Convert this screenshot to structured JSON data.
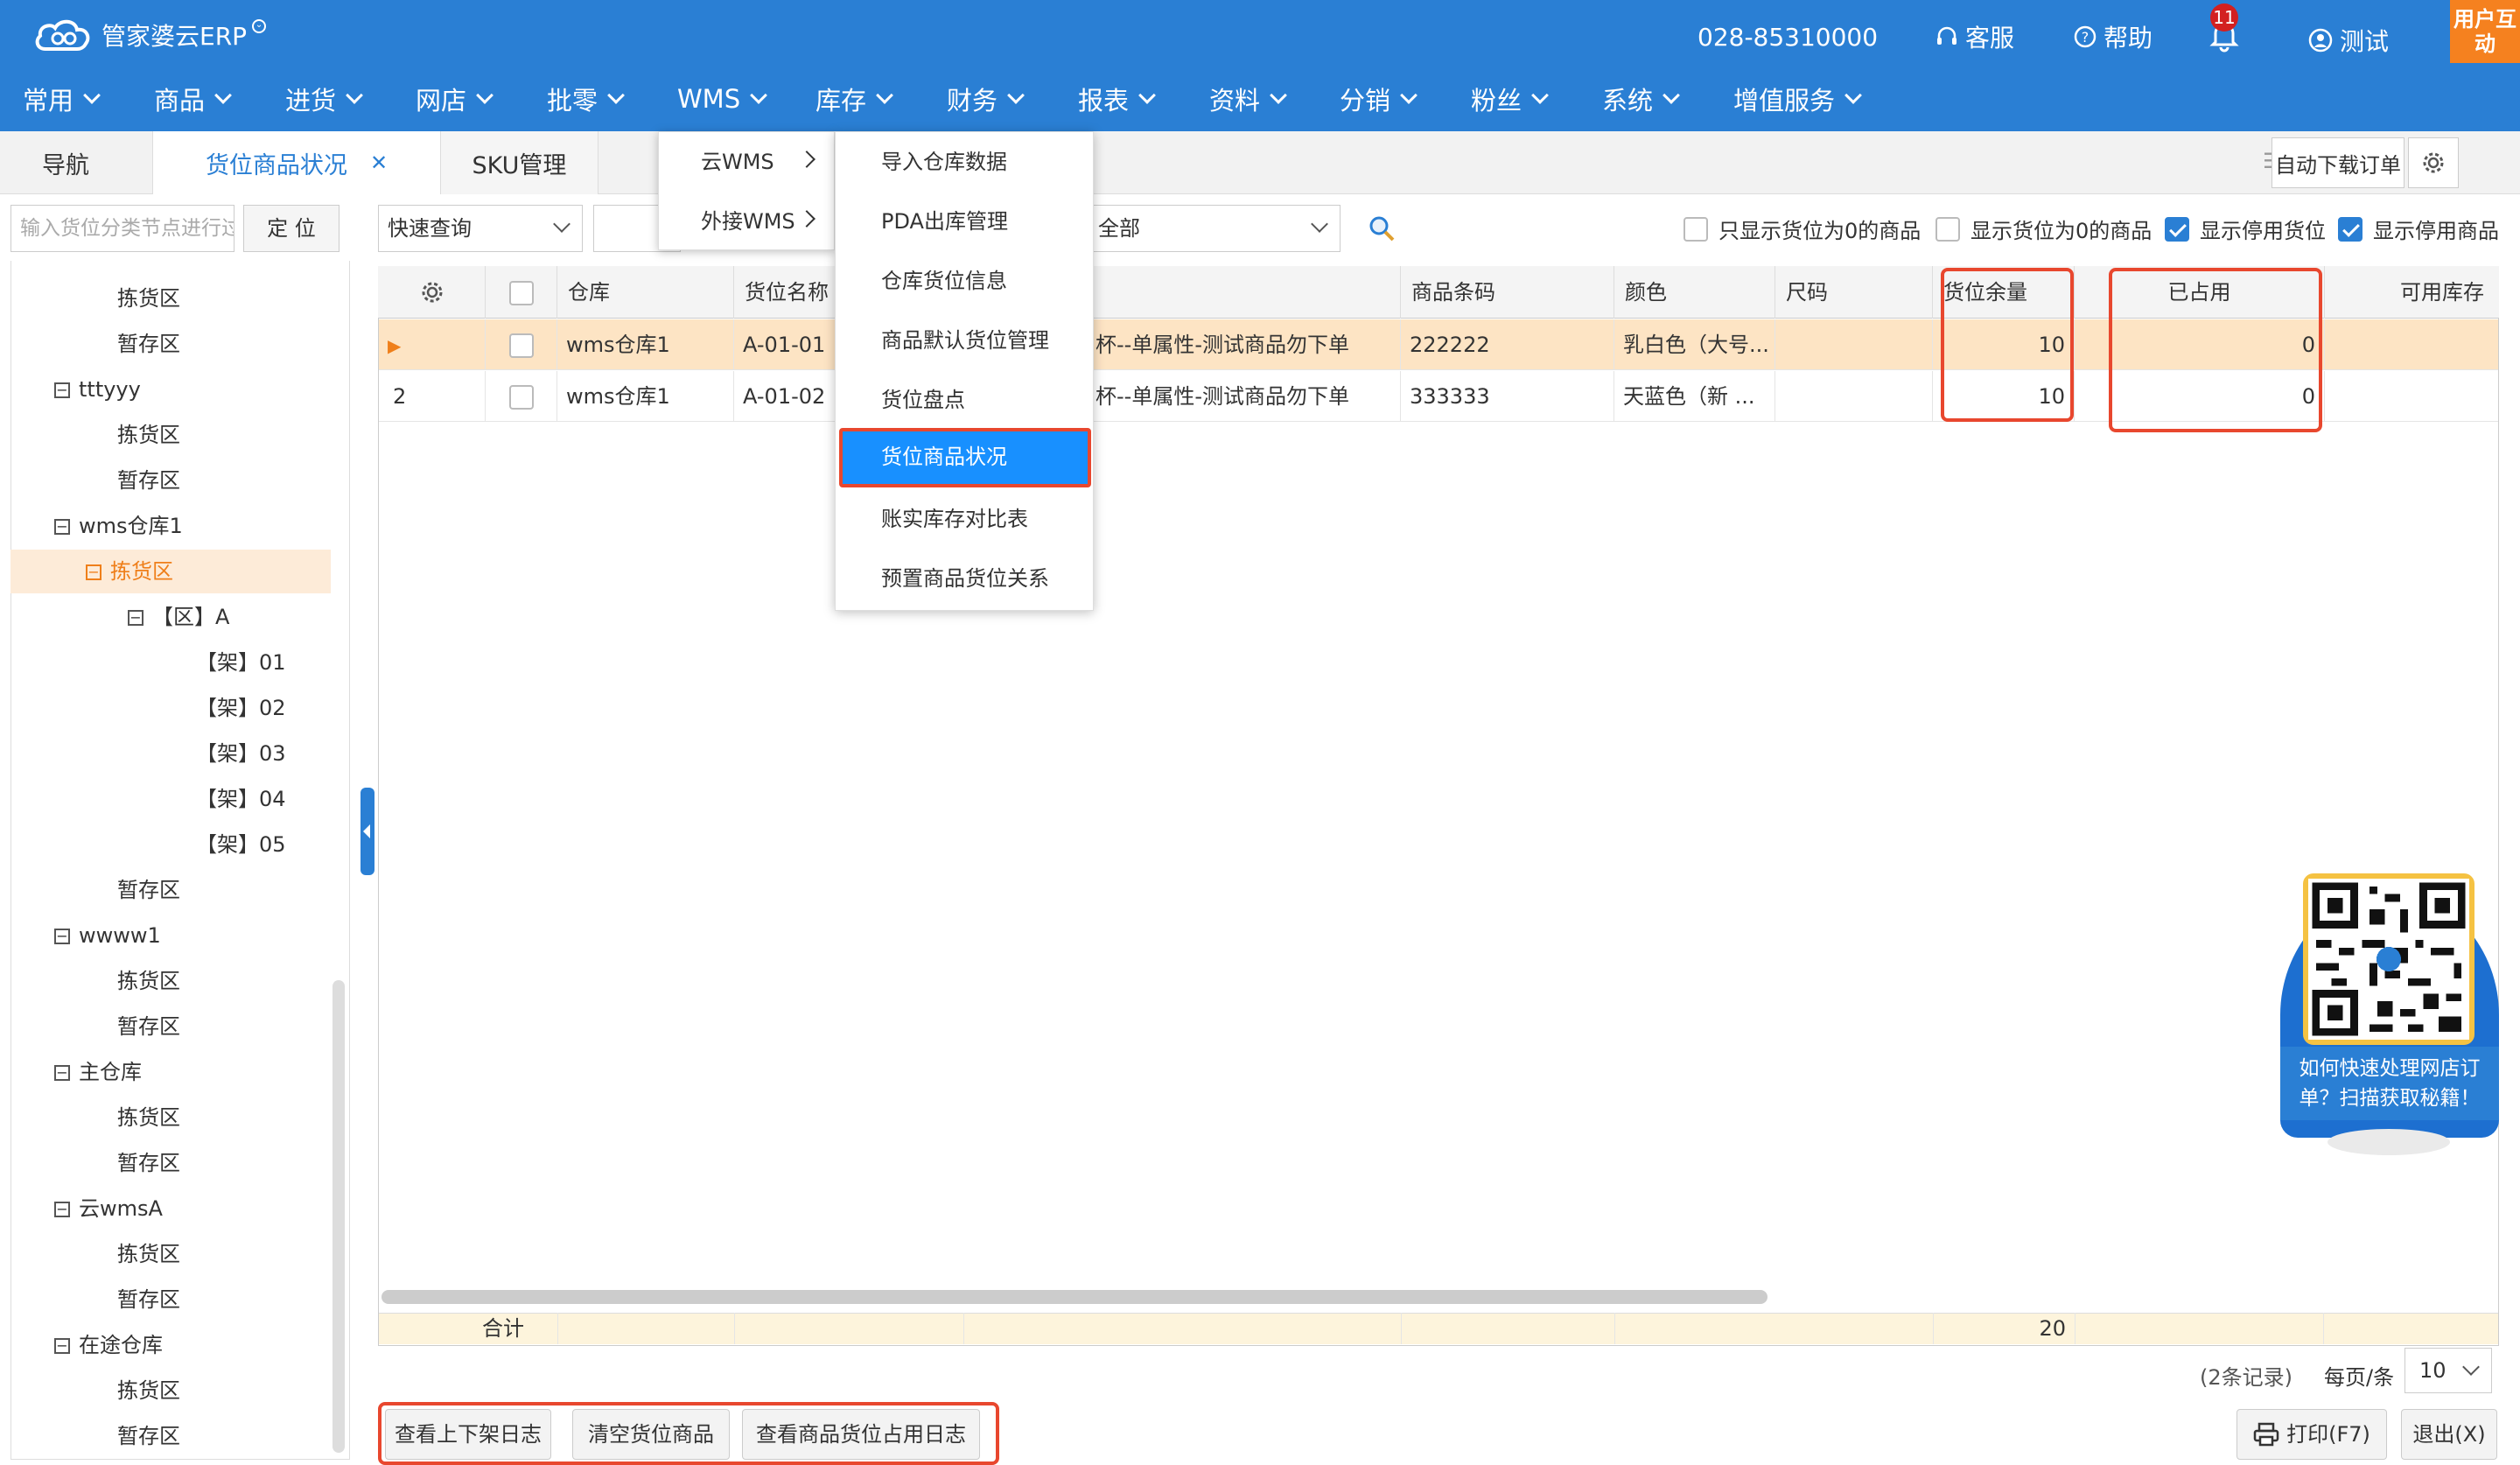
{
  "app": {
    "logo_text": "管家婆云ERP",
    "phone": "028-85310000",
    "service": "客服",
    "help": "帮助",
    "notifications": "11",
    "user": "测试",
    "user_interact": "用户互动"
  },
  "nav": [
    {
      "label": "常用"
    },
    {
      "label": "商品"
    },
    {
      "label": "进货"
    },
    {
      "label": "网店"
    },
    {
      "label": "批零"
    },
    {
      "label": "WMS"
    },
    {
      "label": "库存"
    },
    {
      "label": "财务"
    },
    {
      "label": "报表"
    },
    {
      "label": "资料"
    },
    {
      "label": "分销"
    },
    {
      "label": "粉丝"
    },
    {
      "label": "系统"
    },
    {
      "label": "增值服务"
    }
  ],
  "tabs": {
    "nav": "导航",
    "active": "货位商品状况",
    "sku": "SKU管理",
    "close": "✕"
  },
  "toolbar": {
    "auto_download": "自动下载订单"
  },
  "tree": {
    "search_placeholder": "输入货位分类节点进行过滤",
    "locate": "定 位",
    "nodes": [
      {
        "label": "拣货区"
      },
      {
        "label": "暂存区"
      },
      {
        "label": "tttyyy"
      },
      {
        "label": "拣货区"
      },
      {
        "label": "暂存区"
      },
      {
        "label": "wms仓库1"
      },
      {
        "label": "拣货区"
      },
      {
        "label": "【区】A"
      },
      {
        "label": "【架】01"
      },
      {
        "label": "【架】02"
      },
      {
        "label": "【架】03"
      },
      {
        "label": "【架】04"
      },
      {
        "label": "【架】05"
      },
      {
        "label": "暂存区"
      },
      {
        "label": "wwww1"
      },
      {
        "label": "拣货区"
      },
      {
        "label": "暂存区"
      },
      {
        "label": "主仓库"
      },
      {
        "label": "拣货区"
      },
      {
        "label": "暂存区"
      },
      {
        "label": "云wmsA"
      },
      {
        "label": "拣货区"
      },
      {
        "label": "暂存区"
      },
      {
        "label": "在途仓库"
      },
      {
        "label": "拣货区"
      },
      {
        "label": "暂存区"
      }
    ]
  },
  "filters": {
    "quick": "快速查询",
    "scope": "全部",
    "chk_only_zero": "只显示货位为0的商品",
    "chk_show_zero": "显示货位为0的商品",
    "chk_disabled_loc": "显示停用货位",
    "chk_disabled_goods": "显示停用商品"
  },
  "grid": {
    "headers": {
      "warehouse": "仓库",
      "location": "货位名称",
      "barcode": "商品条码",
      "color": "颜色",
      "size": "尺码",
      "remain": "货位余量",
      "occupied": "已占用",
      "available": "可用库存"
    },
    "rows": [
      {
        "idx": "",
        "warehouse": "wms仓库1",
        "location": "A-01-01",
        "name": "杯--单属性-测试商品勿下单",
        "barcode": "222222",
        "color": "乳白色（大号...",
        "size": "",
        "remain": "10",
        "occupied": "0"
      },
      {
        "idx": "2",
        "warehouse": "wms仓库1",
        "location": "A-01-02",
        "name": "杯--单属性-测试商品勿下单",
        "barcode": "333333",
        "color": "天蓝色（新 ...",
        "size": "",
        "remain": "10",
        "occupied": "0"
      }
    ],
    "sum_label": "合计",
    "sum_remain": "20"
  },
  "menu_wms": {
    "items": [
      {
        "label": "云WMS"
      },
      {
        "label": "外接WMS"
      }
    ],
    "sub": [
      {
        "label": "导入仓库数据"
      },
      {
        "label": "PDA出库管理"
      },
      {
        "label": "仓库货位信息"
      },
      {
        "label": "商品默认货位管理"
      },
      {
        "label": "货位盘点"
      },
      {
        "label": "货位商品状况"
      },
      {
        "label": "账实库存对比表"
      },
      {
        "label": "预置商品货位关系"
      }
    ]
  },
  "pager": {
    "records": "(2条记录)",
    "per_page_label": "每页/条",
    "per_page": "10"
  },
  "bottom_buttons": {
    "log_shelf": "查看上下架日志",
    "clear_loc": "清空货位商品",
    "log_occupy": "查看商品货位占用日志",
    "print": "打印(F7)",
    "exit": "退出(X)"
  },
  "promo": {
    "text": "如何快速处理网店订单？扫描获取秘籍！"
  },
  "colors": {
    "header_blue": "#2a7fd4",
    "accent_orange": "#f5811f",
    "highlight_red": "#e8472e",
    "row_selected": "#fde4c4"
  }
}
